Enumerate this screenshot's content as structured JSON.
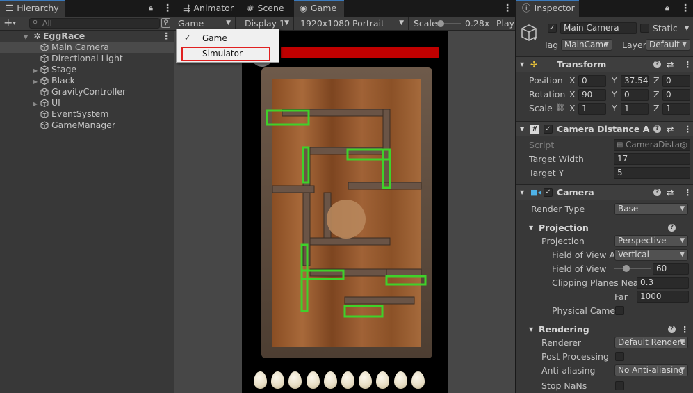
{
  "tabs_left": {
    "hierarchy": "Hierarchy"
  },
  "tabs_center": {
    "animator": "Animator",
    "scene": "Scene",
    "game": "Game"
  },
  "tabs_right": {
    "inspector": "Inspector"
  },
  "hierarchy": {
    "search_placeholder": "All",
    "scene_name": "EggRace",
    "items": [
      {
        "label": "Main Camera",
        "selected": true
      },
      {
        "label": "Directional Light"
      },
      {
        "label": "Stage",
        "expandable": true
      },
      {
        "label": "Black",
        "expandable": true
      },
      {
        "label": "GravityController"
      },
      {
        "label": "UI",
        "expandable": true
      },
      {
        "label": "EventSystem"
      },
      {
        "label": "GameManager"
      }
    ]
  },
  "gamebar": {
    "mode": "Game",
    "display": "Display 1",
    "resolution": "1920x1080 Portrait",
    "scale_label": "Scale",
    "scale_value": "0.28x",
    "scale_level": 0.1,
    "play": "Play"
  },
  "dropdown": {
    "items": [
      {
        "label": "Game",
        "checked": true
      },
      {
        "label": "Simulator",
        "checked": false
      }
    ]
  },
  "game": {
    "egg_count": 10
  },
  "inspector": {
    "object_name": "Main Camera",
    "static_label": "Static",
    "tag_label": "Tag",
    "tag_value": "MainCame",
    "layer_label": "Layer",
    "layer_value": "Default",
    "transform": {
      "title": "Transform",
      "position_label": "Position",
      "rotation_label": "Rotation",
      "scale_label": "Scale",
      "position": {
        "x": "0",
        "y": "37.54",
        "z": "0"
      },
      "rotation": {
        "x": "90",
        "y": "0",
        "z": "0"
      },
      "scale": {
        "x": "1",
        "y": "1",
        "z": "1"
      }
    },
    "cam_distance": {
      "title": "Camera Distance Adju",
      "script_label": "Script",
      "script_value": "CameraDistar",
      "target_width_label": "Target Width",
      "target_width": "17",
      "target_y_label": "Target Y",
      "target_y": "5"
    },
    "camera": {
      "title": "Camera",
      "render_type_label": "Render Type",
      "render_type": "Base",
      "projection_header": "Projection",
      "projection_label": "Projection",
      "projection": "Perspective",
      "fov_axis_label": "Field of View Ax",
      "fov_axis": "Vertical",
      "fov_label": "Field of View",
      "fov": "60",
      "fov_level": 0.33,
      "clip_label": "Clipping Planes Near",
      "near": "0.3",
      "far_label": "Far",
      "far": "1000",
      "physical_label": "Physical Camera",
      "rendering_header": "Rendering",
      "renderer_label": "Renderer",
      "renderer": "Default Rendere",
      "post_label": "Post Processing",
      "aa_label": "Anti-aliasing",
      "aa": "No Anti-aliasing",
      "stopnan_label": "Stop NaNs"
    },
    "axes": {
      "x": "X",
      "y": "Y",
      "z": "Z"
    }
  }
}
